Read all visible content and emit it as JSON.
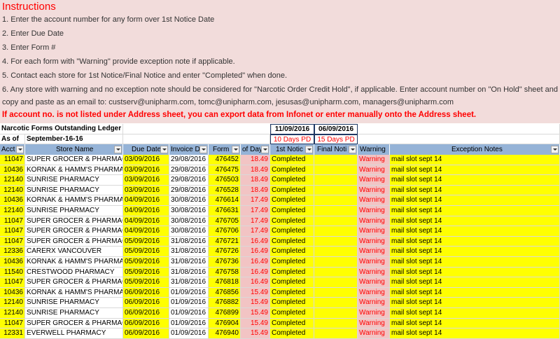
{
  "instructions": {
    "title": "Instructions",
    "steps": [
      "1. Enter the account number for any form over 1st Notice Date",
      "2. Enter Due Date",
      "3. Enter Form #",
      "4. For each form with \"Warning\" provide exception note if applicable.",
      "5. Contact each store for 1st Notice/Final Notice and enter \"Completed\" when done.",
      "6. Any store with warning and no exception note should be considered for \"Narcotic Order Credit Hold\", if applicable. Enter account number on \"On Hold\" sheet and",
      "    copy and paste as an email to: custserv@unipharm.com, tomc@unipharm.com, jesusas@unipharm.com, managers@unipharm.com"
    ],
    "warning": "If account no. is not listed under Address sheet, you can export data from Infonet or enter manually onto the Address sheet."
  },
  "ledger": {
    "title": "Narcotic Forms Outstanding Ledger",
    "as_of_label": "As of",
    "as_of_date": "September-16-16",
    "first_notice_date": "11/09/2016",
    "final_notice_date": "06/09/2016",
    "first_notice_note": "10 Days PD",
    "final_notice_note": "15 Days PD"
  },
  "columns": [
    "Acct",
    "Store Name",
    "Due Date",
    "Invoice D",
    "Form",
    "of Day",
    "1st Notic",
    "Final Noti",
    "Warning",
    "Exception Notes"
  ],
  "rows": [
    [
      "11047",
      "SUPER GROCER & PHARMACY",
      "03/09/2016",
      "29/08/2016",
      "476452",
      "18.49",
      "Completed",
      "",
      "Warning",
      "mail slot sept 14"
    ],
    [
      "10436",
      "KORNAK & HAMM'S PHARMACY",
      "03/09/2016",
      "29/08/2016",
      "476475",
      "18.49",
      "Completed",
      "",
      "Warning",
      "mail slot sept 14"
    ],
    [
      "12140",
      "SUNRISE PHARMACY",
      "03/09/2016",
      "29/08/2016",
      "476503",
      "18.49",
      "Completed",
      "",
      "Warning",
      "mail slot sept 14"
    ],
    [
      "12140",
      "SUNRISE PHARMACY",
      "03/09/2016",
      "29/08/2016",
      "476528",
      "18.49",
      "Completed",
      "",
      "Warning",
      "mail slot sept 14"
    ],
    [
      "10436",
      "KORNAK & HAMM'S PHARMACY",
      "04/09/2016",
      "30/08/2016",
      "476614",
      "17.49",
      "Completed",
      "",
      "Warning",
      "mail slot sept 14"
    ],
    [
      "12140",
      "SUNRISE PHARMACY",
      "04/09/2016",
      "30/08/2016",
      "476631",
      "17.49",
      "Completed",
      "",
      "Warning",
      "mail slot sept 14"
    ],
    [
      "11047",
      "SUPER GROCER & PHARMACY",
      "04/09/2016",
      "30/08/2016",
      "476705",
      "17.49",
      "Completed",
      "",
      "Warning",
      "mail slot sept 14"
    ],
    [
      "11047",
      "SUPER GROCER & PHARMACY",
      "04/09/2016",
      "30/08/2016",
      "476706",
      "17.49",
      "Completed",
      "",
      "Warning",
      "mail slot sept 14"
    ],
    [
      "11047",
      "SUPER GROCER & PHARMACY",
      "05/09/2016",
      "31/08/2016",
      "476721",
      "16.49",
      "Completed",
      "",
      "Warning",
      "mail slot sept 14"
    ],
    [
      "12336",
      "CARERX VANCOUVER",
      "05/09/2016",
      "31/08/2016",
      "476726",
      "16.49",
      "Completed",
      "",
      "Warning",
      "mail slot sept 14"
    ],
    [
      "10436",
      "KORNAK & HAMM'S PHARMACY",
      "05/09/2016",
      "31/08/2016",
      "476736",
      "16.49",
      "Completed",
      "",
      "Warning",
      "mail slot sept 14"
    ],
    [
      "11540",
      "CRESTWOOD PHARMACY",
      "05/09/2016",
      "31/08/2016",
      "476758",
      "16.49",
      "Completed",
      "",
      "Warning",
      "mail slot sept 14"
    ],
    [
      "11047",
      "SUPER GROCER & PHARMACY",
      "05/09/2016",
      "31/08/2016",
      "476818",
      "16.49",
      "Completed",
      "",
      "Warning",
      "mail slot sept 14"
    ],
    [
      "10436",
      "KORNAK & HAMM'S PHARMACY",
      "06/09/2016",
      "01/09/2016",
      "476856",
      "15.49",
      "Completed",
      "",
      "Warning",
      "mail slot sept 14"
    ],
    [
      "12140",
      "SUNRISE PHARMACY",
      "06/09/2016",
      "01/09/2016",
      "476882",
      "15.49",
      "Completed",
      "",
      "Warning",
      "mail slot sept 14"
    ],
    [
      "12140",
      "SUNRISE PHARMACY",
      "06/09/2016",
      "01/09/2016",
      "476899",
      "15.49",
      "Completed",
      "",
      "Warning",
      "mail slot sept 14"
    ],
    [
      "11047",
      "SUPER GROCER & PHARMACY",
      "06/09/2016",
      "01/09/2016",
      "476904",
      "15.49",
      "Completed",
      "",
      "Warning",
      "mail slot sept 14"
    ],
    [
      "12331",
      "EVERWELL PHARMACY",
      "06/09/2016",
      "01/09/2016",
      "476940",
      "15.49",
      "Completed",
      "",
      "Warning",
      "mail slot sept 14"
    ]
  ],
  "colors": {
    "instructions_bg": "#f2dcdb",
    "header_bg": "#95b3d7",
    "highlight_yellow": "#ffff00",
    "warning_pink": "#f2c4c4",
    "alert_red": "#ff0000"
  }
}
